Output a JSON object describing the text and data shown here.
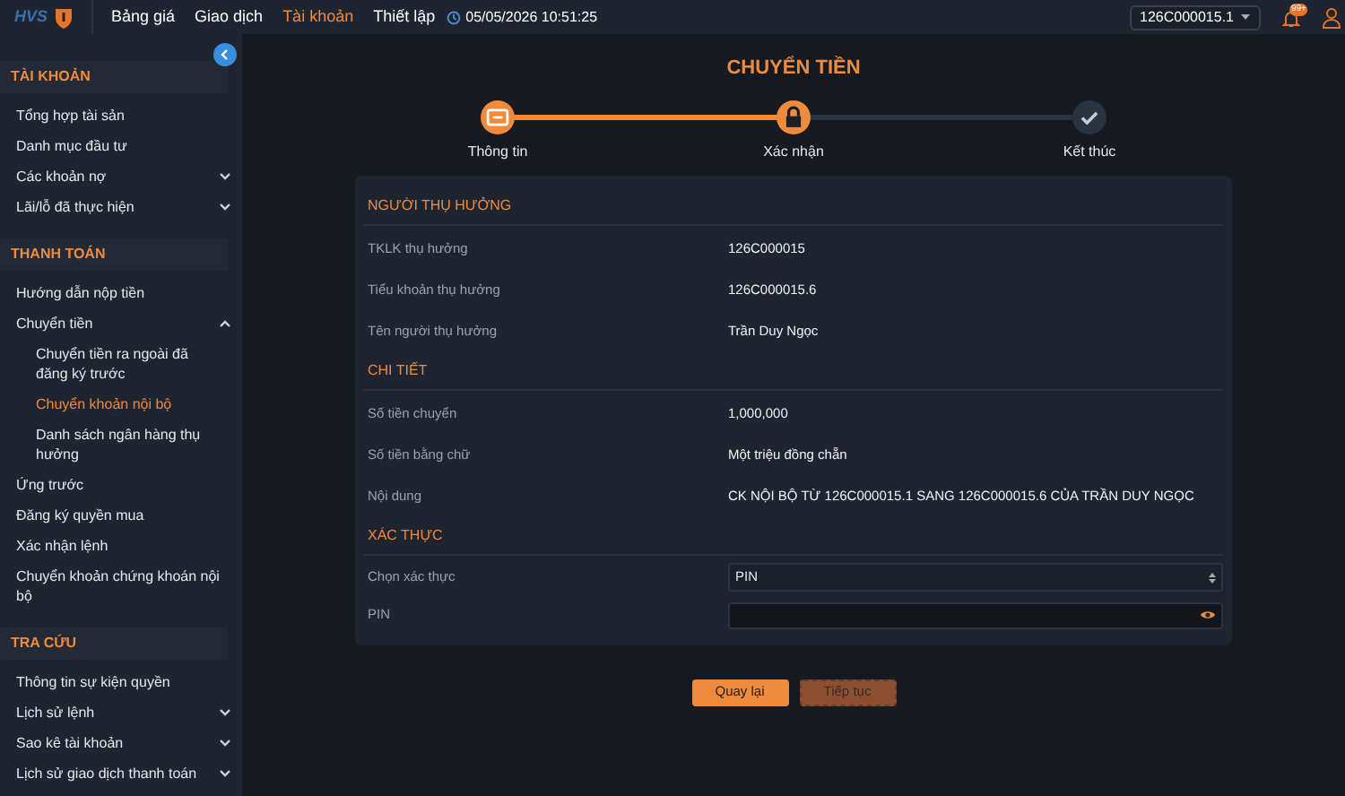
{
  "topbar": {
    "logo": "HVS",
    "nav": [
      {
        "label": "Bảng giá",
        "selected": false
      },
      {
        "label": "Giao dịch",
        "selected": false
      },
      {
        "label": "Tài khoản",
        "selected": true
      },
      {
        "label": "Thiết lập",
        "selected": false
      }
    ],
    "datetime": "05/05/2026 10:51:25",
    "account": "126C000015.1",
    "notification_badge": "99+"
  },
  "sidebar": {
    "sections": [
      {
        "title": "TÀI KHOẢN",
        "items": [
          {
            "label": "Tổng hợp tài sản",
            "selected": false
          },
          {
            "label": "Danh mục đầu tư",
            "selected": false
          },
          {
            "label": "Các khoản nợ",
            "selected": false,
            "expanded": false
          },
          {
            "label": "Lãi/lỗ đã thực hiện",
            "selected": false,
            "expanded": false
          }
        ]
      },
      {
        "title": "THANH TOÁN",
        "items": [
          {
            "label": "Hướng dẫn nộp tiền",
            "selected": false
          },
          {
            "label": "Chuyển tiền",
            "selected": false,
            "expanded": true,
            "children": [
              {
                "label": "Chuyển tiền ra ngoài đã đăng ký trước",
                "selected": false
              },
              {
                "label": "Chuyển khoản nội bộ",
                "selected": true
              },
              {
                "label": "Danh sách ngân hàng thụ hưởng",
                "selected": false
              }
            ]
          },
          {
            "label": "Ứng trước",
            "selected": false
          },
          {
            "label": "Đăng ký quyền mua",
            "selected": false
          },
          {
            "label": "Xác nhận lệnh",
            "selected": false
          },
          {
            "label": "Chuyển khoản chứng khoán nội bộ",
            "selected": false
          }
        ]
      },
      {
        "title": "TRA CỨU",
        "items": [
          {
            "label": "Thông tin sự kiện quyền",
            "selected": false
          },
          {
            "label": "Lịch sử lệnh",
            "selected": false,
            "expanded": false
          },
          {
            "label": "Sao kê tài khoản",
            "selected": false,
            "expanded": false
          },
          {
            "label": "Lịch sử giao dịch thanh toán",
            "selected": false,
            "expanded": false
          }
        ]
      }
    ]
  },
  "page_title": "CHUYỂN TIỀN",
  "steps": [
    {
      "label": "Thông tin",
      "reached": true
    },
    {
      "label": "Xác nhận",
      "reached": true
    },
    {
      "label": "Kết thúc",
      "reached": false
    }
  ],
  "sections": [
    {
      "title": "NGƯỜI THỤ HƯỞNG",
      "rows": [
        {
          "label": "TKLK thụ hưởng",
          "value": "126C000015"
        },
        {
          "label": "Tiểu khoản thụ hưởng",
          "value": "126C000015.6"
        },
        {
          "label": "Tên người thụ hưởng",
          "value": "Trần Duy Ngọc"
        }
      ]
    },
    {
      "title": "CHI TIẾT",
      "rows": [
        {
          "label": "Số tiền chuyển",
          "value": "1,000,000"
        },
        {
          "label": "Số tiền bằng chữ",
          "value": "Một triệu đồng chẵn"
        },
        {
          "label": "Nội dung",
          "value": "CK NỘI BỘ TỪ 126C000015.1 SANG 126C000015.6 CỦA TRẦN DUY NGỌC"
        }
      ]
    },
    {
      "title": "XÁC THỰC",
      "rows": [
        {
          "label": "Chọn xác thực",
          "kind": "select",
          "value": "PIN"
        },
        {
          "label": "PIN",
          "kind": "password"
        }
      ]
    }
  ],
  "buttons": [
    {
      "label": "Quay lại",
      "disabled": false
    },
    {
      "label": "Tiếp tục",
      "disabled": true
    }
  ]
}
